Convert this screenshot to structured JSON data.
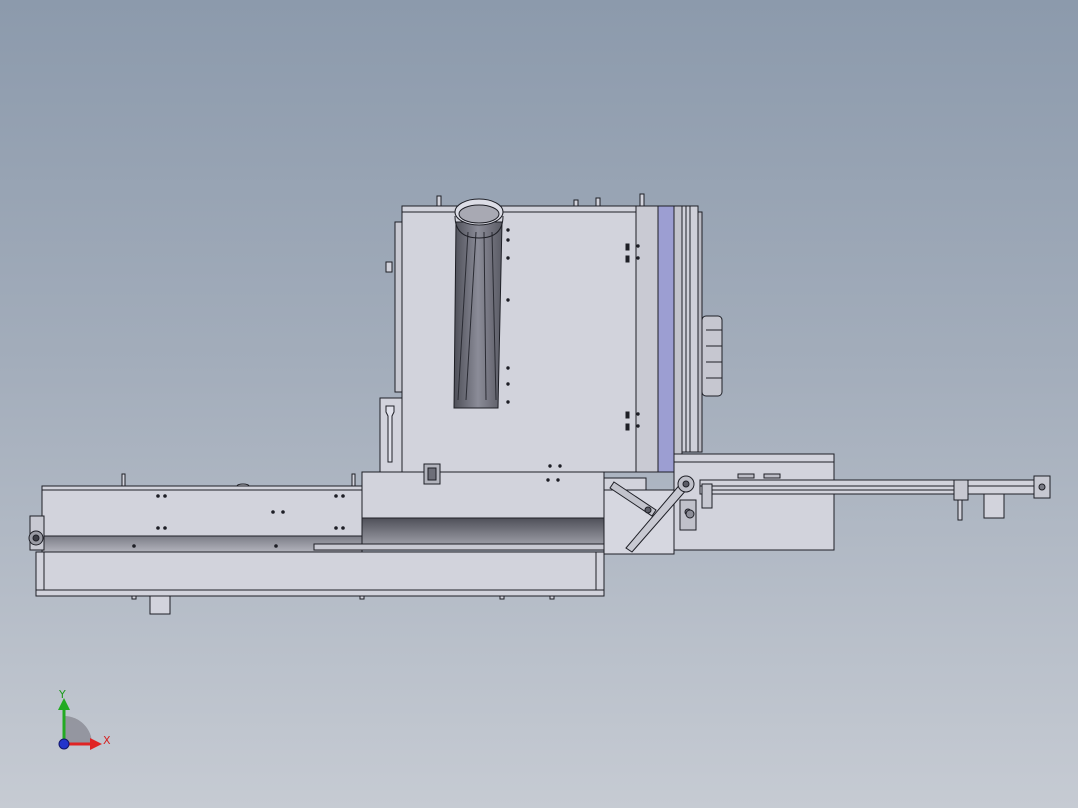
{
  "viewport": {
    "background_top": "#8c9aac",
    "background_bottom": "#c6cbd3",
    "part_fill": "#d2d3dc",
    "edge_color": "#1e1f26",
    "accent_blue": "#9c9ed2",
    "dark_band": "#5b5c66"
  },
  "triad": {
    "x_label": "X",
    "y_label": "Y",
    "x_color": "#e02424",
    "y_color": "#22aa22",
    "z_color": "#2234cc"
  }
}
